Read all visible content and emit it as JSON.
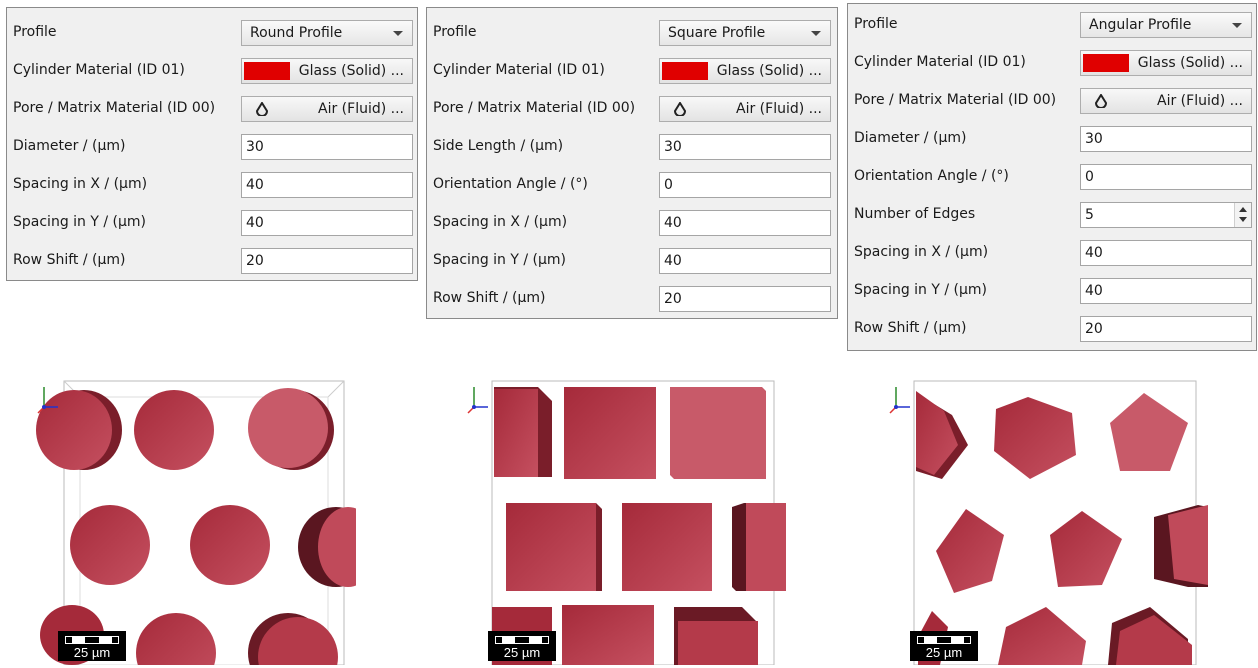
{
  "panels": [
    {
      "profile": {
        "label": "Profile",
        "value": "Round Profile"
      },
      "cylinder_material": {
        "label": "Cylinder Material (ID 01)",
        "value": "Glass (Solid) ..."
      },
      "pore_material": {
        "label": "Pore / Matrix Material (ID 00)",
        "value": "Air (Fluid) ..."
      },
      "fields": [
        {
          "label": "Diameter / (µm)",
          "value": "30"
        },
        {
          "label": "Spacing in X / (µm)",
          "value": "40"
        },
        {
          "label": "Spacing in Y / (µm)",
          "value": "40"
        },
        {
          "label": "Row Shift / (µm)",
          "value": "20"
        }
      ]
    },
    {
      "profile": {
        "label": "Profile",
        "value": "Square Profile"
      },
      "cylinder_material": {
        "label": "Cylinder Material (ID 01)",
        "value": "Glass (Solid) ..."
      },
      "pore_material": {
        "label": "Pore / Matrix Material (ID 00)",
        "value": "Air (Fluid) ..."
      },
      "fields": [
        {
          "label": "Side Length / (µm)",
          "value": "30"
        },
        {
          "label": "Orientation Angle / (°)",
          "value": "0"
        },
        {
          "label": "Spacing in X / (µm)",
          "value": "40"
        },
        {
          "label": "Spacing in Y / (µm)",
          "value": "40"
        },
        {
          "label": "Row Shift / (µm)",
          "value": "20"
        }
      ]
    },
    {
      "profile": {
        "label": "Profile",
        "value": "Angular Profile"
      },
      "cylinder_material": {
        "label": "Cylinder Material (ID 01)",
        "value": "Glass (Solid) ..."
      },
      "pore_material": {
        "label": "Pore / Matrix Material (ID 00)",
        "value": "Air (Fluid) ..."
      },
      "fields": [
        {
          "label": "Diameter / (µm)",
          "value": "30"
        },
        {
          "label": "Orientation Angle / (°)",
          "value": "0"
        },
        {
          "label": "Number of Edges",
          "value": "5",
          "spinbox": true
        },
        {
          "label": "Spacing in X / (µm)",
          "value": "40"
        },
        {
          "label": "Spacing in Y / (µm)",
          "value": "40"
        },
        {
          "label": "Row Shift / (µm)",
          "value": "20"
        }
      ]
    }
  ],
  "views": [
    {
      "scale_label": "25 µm",
      "axis_y": "Y",
      "axis_x": "X"
    },
    {
      "scale_label": "25 µm",
      "axis_y": "Y",
      "axis_x": "X"
    },
    {
      "scale_label": "25 µm",
      "axis_y": "Y",
      "axis_x": "X"
    }
  ],
  "colors": {
    "material_swatch": "#e00000",
    "cylinder_fill": "#b0303f",
    "cylinder_shade": "#7a1e2a"
  },
  "icons": {
    "dropdown": "chevron-down-icon",
    "fluid": "droplet-icon",
    "spin": "spin-arrows-icon"
  }
}
